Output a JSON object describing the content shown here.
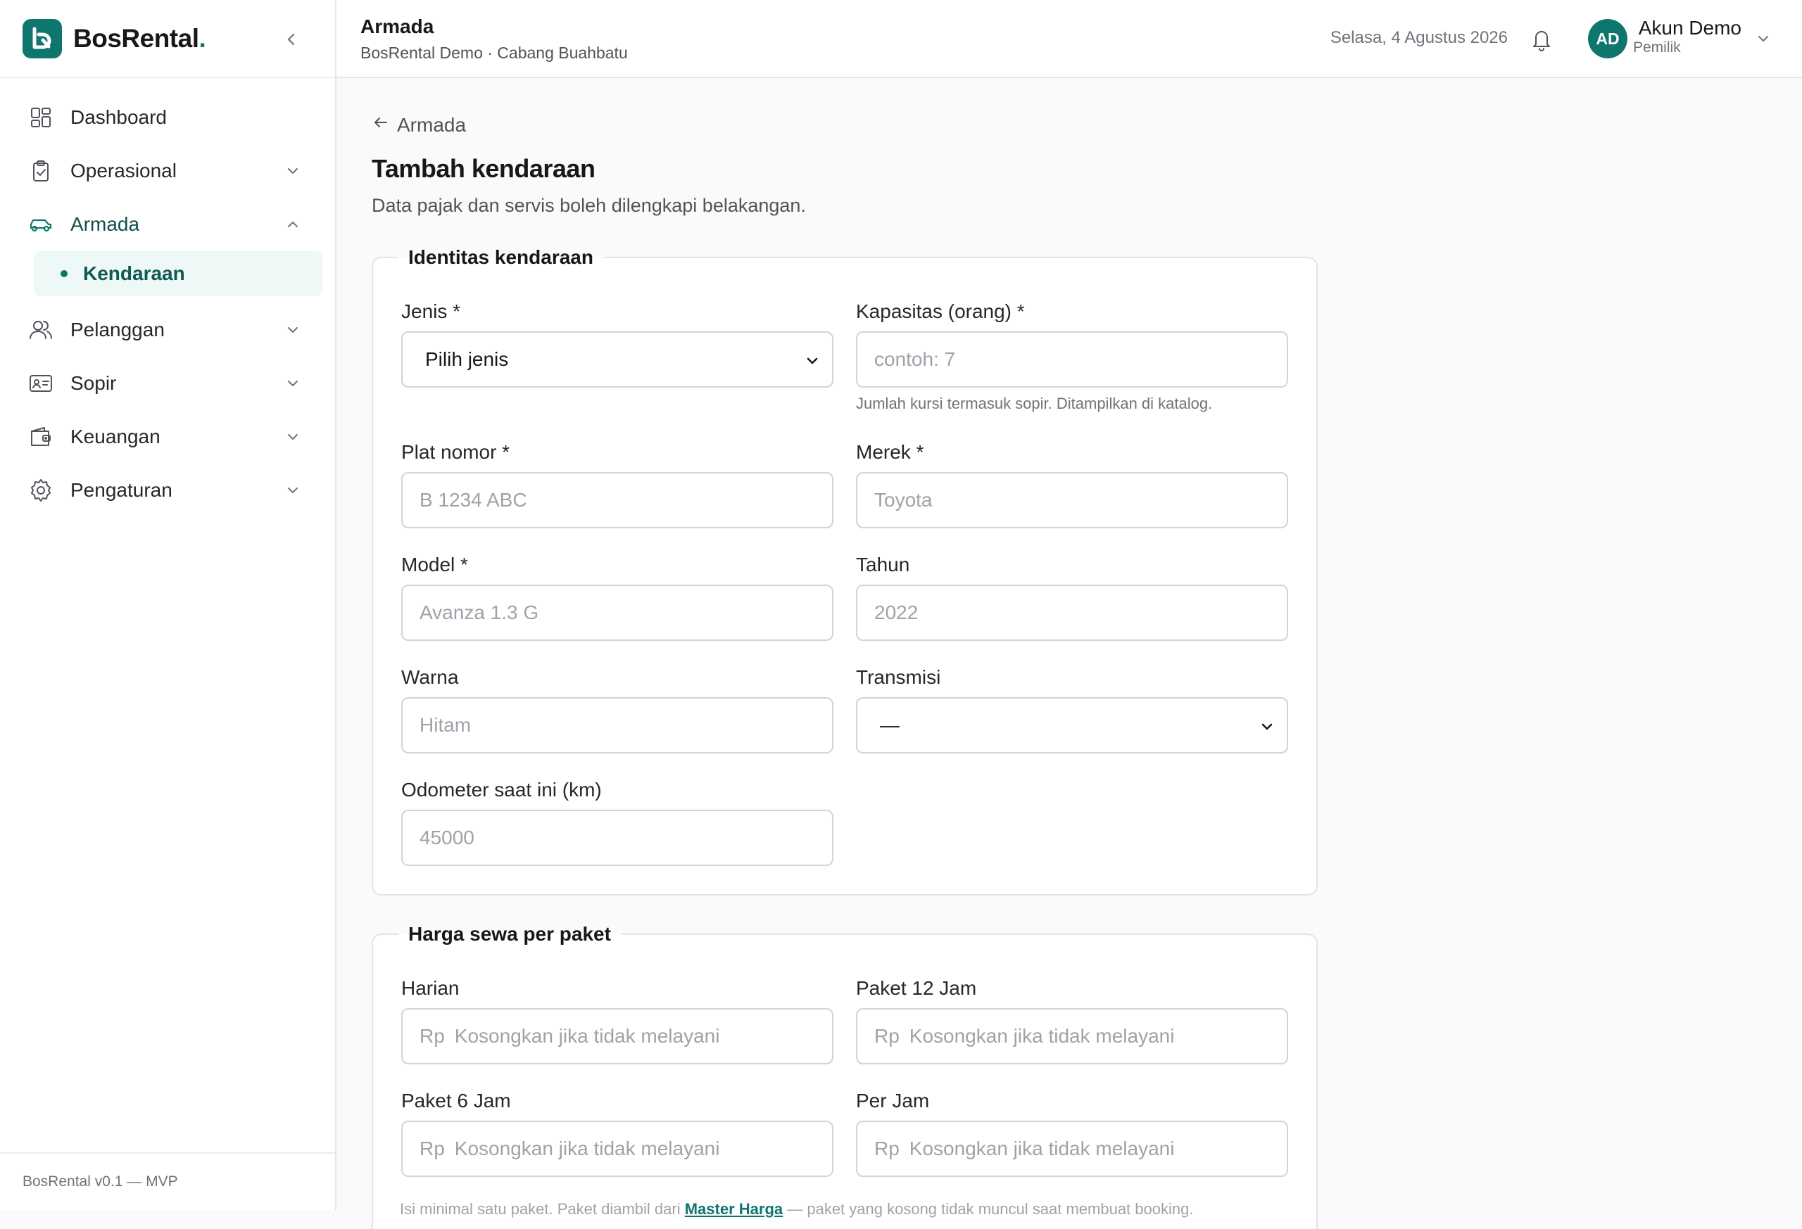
{
  "brand": {
    "name": "BosRental",
    "dot": "."
  },
  "sidebar": {
    "items": [
      {
        "label": "Dashboard"
      },
      {
        "label": "Operasional"
      },
      {
        "label": "Armada"
      },
      {
        "sub_label": "Kendaraan"
      },
      {
        "label": "Pelanggan"
      },
      {
        "label": "Sopir"
      },
      {
        "label": "Keuangan"
      },
      {
        "label": "Pengaturan"
      }
    ],
    "footer": "BosRental v0.1 — MVP"
  },
  "header": {
    "title": "Armada",
    "subtitle": "BosRental Demo · Cabang Buahbatu",
    "date": "Selasa, 4 Agustus 2026",
    "user": {
      "initials": "AD",
      "name": "Akun Demo",
      "role": "Pemilik"
    }
  },
  "page": {
    "back_label": "Armada",
    "title": "Tambah kendaraan",
    "subtitle": "Data pajak dan servis boleh dilengkapi belakangan."
  },
  "identity": {
    "legend": "Identitas kendaraan",
    "jenis": {
      "label": "Jenis *",
      "value": "Pilih jenis"
    },
    "kapasitas": {
      "label": "Kapasitas (orang) *",
      "placeholder": "contoh: 7",
      "help": "Jumlah kursi termasuk sopir. Ditampilkan di katalog."
    },
    "plat": {
      "label": "Plat nomor *",
      "placeholder": "B 1234 ABC"
    },
    "merek": {
      "label": "Merek *",
      "placeholder": "Toyota"
    },
    "model": {
      "label": "Model *",
      "placeholder": "Avanza 1.3 G"
    },
    "tahun": {
      "label": "Tahun",
      "placeholder": "2022"
    },
    "warna": {
      "label": "Warna",
      "placeholder": "Hitam"
    },
    "transmisi": {
      "label": "Transmisi",
      "value": "—"
    },
    "odometer": {
      "label": "Odometer saat ini (km)",
      "placeholder": "45000"
    }
  },
  "pricing": {
    "legend": "Harga sewa per paket",
    "currency": "Rp",
    "placeholder": "Kosongkan jika tidak melayani",
    "harian": {
      "label": "Harian"
    },
    "paket12": {
      "label": "Paket 12 Jam"
    },
    "paket6": {
      "label": "Paket 6 Jam"
    },
    "perjam": {
      "label": "Per Jam"
    },
    "note_prefix": "Isi minimal satu paket. Paket diambil dari ",
    "note_link": "Master Harga",
    "note_suffix": " — paket yang kosong tidak muncul saat membuat booking."
  },
  "colors": {
    "accent": "#0f766e",
    "accent_light": "#eef8f6"
  }
}
